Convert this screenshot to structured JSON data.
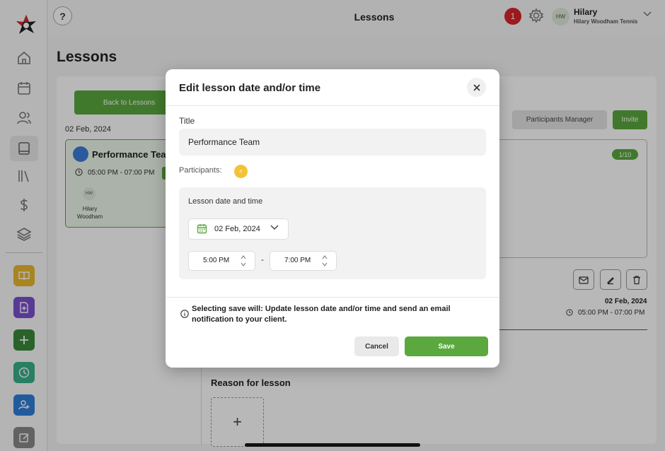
{
  "topbar": {
    "help": "?",
    "title": "Lessons",
    "notifications": "1",
    "avatar_initials": "HW",
    "user_name": "Hilary",
    "user_org": "Hilary Woodham Tennis"
  },
  "page": {
    "title": "Lessons",
    "back_label": "Back to Lessons",
    "date": "02 Feb, 2024"
  },
  "lesson_card": {
    "name": "Performance Team",
    "time": "05:00 PM - 07:00 PM",
    "participant_initials": "HW",
    "participant_name": "Hilary Woodham"
  },
  "right": {
    "participants_manager": "Participants Manager",
    "invite": "Invite",
    "count": "1/10",
    "date": "02 Feb, 2024",
    "time": "05:00 PM - 07:00 PM"
  },
  "reason": {
    "label": "Reason for lesson",
    "add": "+"
  },
  "modal": {
    "title": "Edit lesson date and/or time",
    "title_label": "Title",
    "title_value": "Performance Team",
    "participants_label": "Participants:",
    "participant_initials": "H",
    "datetime_label": "Lesson date and time",
    "date_value": "02 Feb, 2024",
    "start_time": "5:00 PM",
    "separator": "-",
    "end_time": "7:00 PM",
    "info": "Selecting save will: Update lesson date and/or time and send an email notification to your client.",
    "cancel": "Cancel",
    "save": "Save"
  },
  "colors": {
    "accent": "#5aa83e",
    "notif": "#d8232a"
  }
}
